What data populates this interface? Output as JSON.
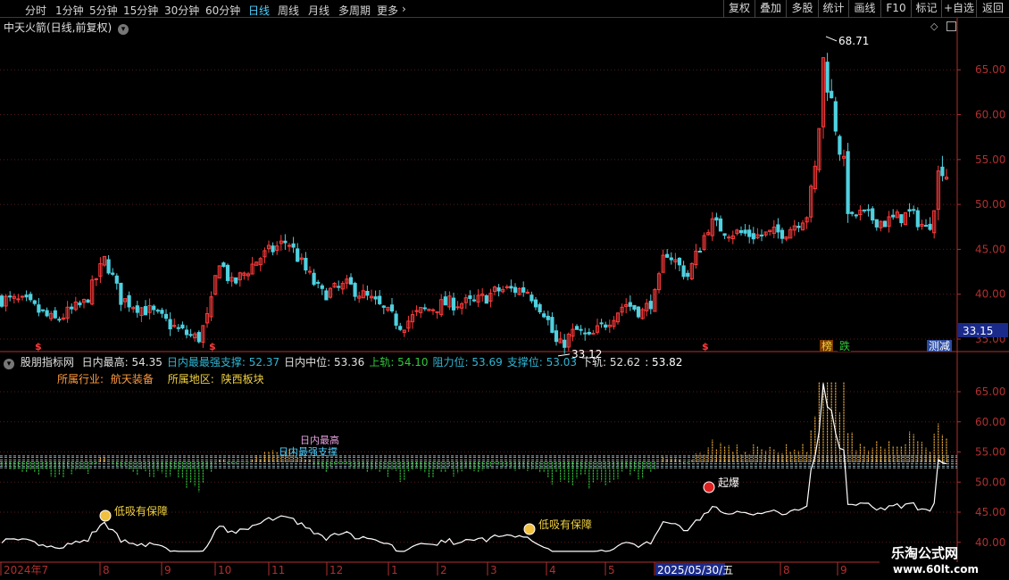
{
  "toolbar": {
    "timeframes": [
      "分时",
      "1分钟",
      "5分钟",
      "15分钟",
      "30分钟",
      "60分钟",
      "日线",
      "周线",
      "月线",
      "多周期",
      "更多"
    ],
    "active_timeframe": "日线",
    "right_buttons": [
      "复权",
      "叠加",
      "多股",
      "统计",
      "画线",
      "F10",
      "标记",
      "+自选",
      "返回"
    ]
  },
  "main_panel": {
    "title": "中天火箭(日线,前复权)",
    "high_label": "68.71",
    "low_label": "33.12",
    "last_price": "33.15",
    "tags": [
      "榜",
      "跌",
      "测减"
    ],
    "dollar_marker": "$"
  },
  "indicator_panel": {
    "name": "股朋指标网",
    "values": [
      {
        "label": "日内最高:",
        "value": "54.35",
        "color": "#e0e0e0"
      },
      {
        "label": "日内最最强支撑:",
        "value": "52.37",
        "color": "#2fb6d4"
      },
      {
        "label": "日内中位:",
        "value": "53.36",
        "color": "#e0e0e0"
      },
      {
        "label": "上轨:",
        "value": "54.10",
        "color": "#31c83a"
      },
      {
        "label": "阻力位:",
        "value": "53.69",
        "color": "#2fb6d4"
      },
      {
        "label": "支撑位:",
        "value": "53.03",
        "color": "#2fb6d4"
      },
      {
        "label": "下轨:",
        "value": "52.62",
        "color": "#e0e0e0"
      },
      {
        "label": ":",
        "value": "53.82",
        "color": "#ffffff"
      }
    ],
    "industry_label": "所属行业:",
    "industry": "航天装备",
    "region_label": "所属地区:",
    "region": "陕西板块",
    "annotations": [
      "低吸有保障",
      "低吸有保障",
      "起爆"
    ],
    "overlap_labels": [
      "日内最高",
      "日内最强支撑"
    ]
  },
  "date_axis": {
    "labels": [
      "2024年7",
      "8",
      "9",
      "10",
      "11",
      "12",
      "1",
      "2",
      "3",
      "4",
      "5",
      "2025/05/30/五",
      "8",
      "9"
    ]
  },
  "watermark": {
    "line1": "乐淘公式网",
    "line2": "www.60lt.com"
  },
  "colors": {
    "up": "#ff3b3b",
    "down": "#4fd1e0",
    "axis": "#b03030",
    "price_line": "#ffffff",
    "highlight": "#f0d040"
  },
  "chart_data": [
    {
      "type": "candlestick",
      "title": "中天火箭(日线,前复权)",
      "y_ticks": [
        35,
        40,
        45,
        50,
        55,
        60,
        65
      ],
      "ylim": [
        35,
        69
      ],
      "x": [
        "2024-07",
        "2024-08",
        "2024-09",
        "2024-10",
        "2024-11",
        "2024-12",
        "2025-01",
        "2025-02",
        "2025-03",
        "2025-04",
        "2025-05",
        "2025-06",
        "2025-07",
        "2025-08",
        "2025-09"
      ],
      "close_approx": [
        39.5,
        42,
        37,
        43,
        44,
        40,
        38,
        40,
        39.5,
        36,
        39,
        48,
        47,
        60,
        52,
        54
      ],
      "high": 68.71,
      "low": 33.12
    },
    {
      "type": "line",
      "title": "股朋指标网",
      "y_ticks": [
        40,
        45,
        50,
        55,
        60,
        65
      ],
      "ylim": [
        37,
        69
      ],
      "bands": [
        54.35,
        54.1,
        53.69,
        53.36,
        53.03,
        52.62,
        52.37
      ]
    }
  ]
}
